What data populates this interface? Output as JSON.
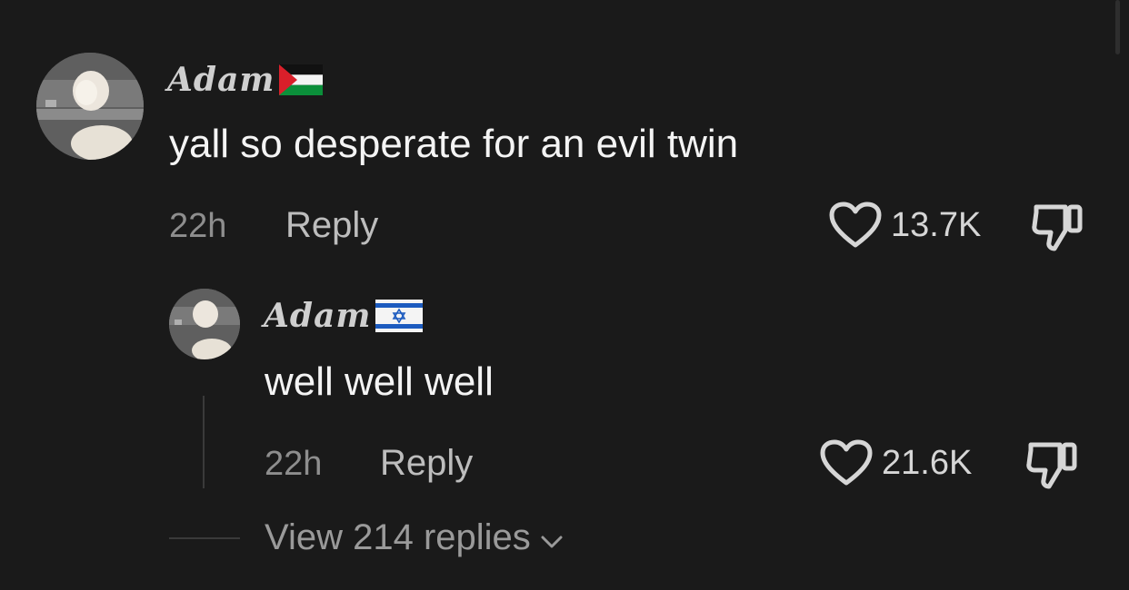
{
  "comments": [
    {
      "username": "Adam",
      "flag_icon": "palestine-flag-icon",
      "text": "yall so desperate for an evil twin",
      "time": "22h",
      "reply_label": "Reply",
      "likes": "13.7K"
    }
  ],
  "replies": [
    {
      "username": "Adam",
      "flag_icon": "israel-flag-icon",
      "text": "well well well",
      "time": "22h",
      "reply_label": "Reply",
      "likes": "21.6K"
    }
  ],
  "view_replies_label": "View 214 replies",
  "colors": {
    "background": "#1a1a1a",
    "text_primary": "#f4f4f4",
    "text_muted": "#8e8e8e"
  }
}
